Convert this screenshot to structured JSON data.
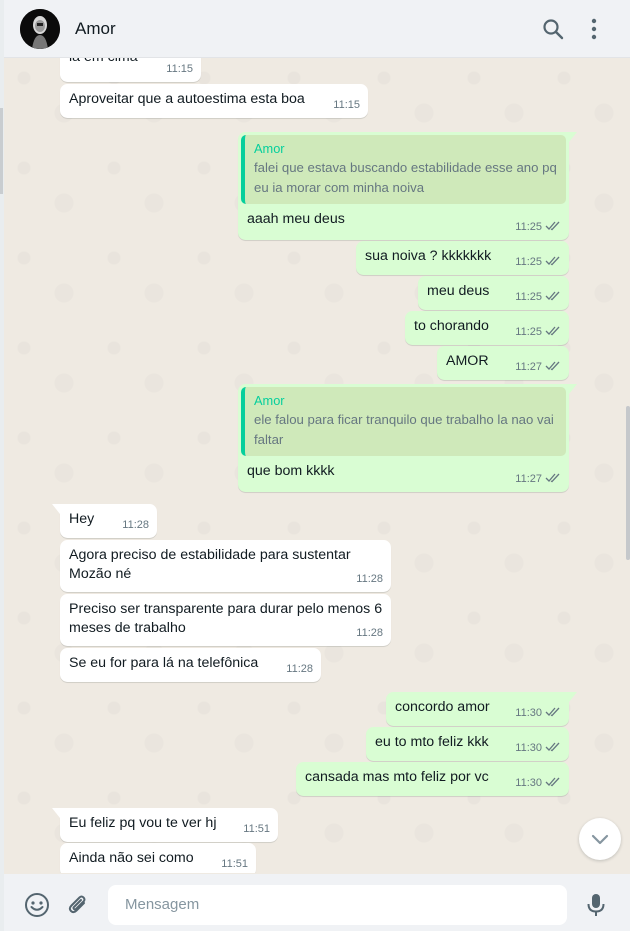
{
  "header": {
    "contact_name": "Amor",
    "icons": [
      "search-icon",
      "menu-icon"
    ]
  },
  "messages": [
    {
      "dir": "in",
      "text": "la em cima",
      "time": "11:15"
    },
    {
      "dir": "in",
      "text": "Aproveitar que a autoestima esta boa",
      "time": "11:15"
    },
    {
      "dir": "out",
      "quote_author": "Amor",
      "quote_text": "falei que estava buscando estabilidade esse ano pq eu ia morar com minha noiva",
      "text": "aaah meu deus",
      "time": "11:25"
    },
    {
      "dir": "out",
      "text": "sua noiva ? kkkkkkk",
      "time": "11:25"
    },
    {
      "dir": "out",
      "text": "meu deus",
      "time": "11:25"
    },
    {
      "dir": "out",
      "text": "to chorando",
      "time": "11:25"
    },
    {
      "dir": "out",
      "text": "AMOR",
      "time": "11:27"
    },
    {
      "dir": "out",
      "quote_author": "Amor",
      "quote_text": "ele falou para ficar tranquilo que trabalho la nao vai faltar",
      "text": "que bom kkkk",
      "time": "11:27"
    },
    {
      "dir": "in",
      "text": "Hey",
      "time": "11:28"
    },
    {
      "dir": "in",
      "text": "Agora preciso de estabilidade para sustentar Mozão né",
      "time": "11:28"
    },
    {
      "dir": "in",
      "text": "Preciso ser transparente para durar pelo menos 6 meses de trabalho",
      "time": "11:28"
    },
    {
      "dir": "in",
      "text": "Se eu for para lá na telefônica",
      "time": "11:28"
    },
    {
      "dir": "out",
      "text": "concordo amor",
      "time": "11:30"
    },
    {
      "dir": "out",
      "text": "eu to mto feliz kkk",
      "time": "11:30"
    },
    {
      "dir": "out",
      "text": "cansada mas mto feliz por vc",
      "time": "11:30"
    },
    {
      "dir": "in",
      "text": "Eu feliz pq vou te ver hj",
      "time": "11:51"
    },
    {
      "dir": "in",
      "text": "Ainda não sei como",
      "time": "11:51"
    }
  ],
  "composer": {
    "placeholder": "Mensagem",
    "icons": [
      "emoji-icon",
      "attach-icon",
      "mic-icon"
    ]
  },
  "colors": {
    "incoming": "#ffffff",
    "outgoing": "#d9fdd3",
    "accent": "#06cf9c",
    "background": "#efeae2",
    "read_ticks": "#667781"
  }
}
